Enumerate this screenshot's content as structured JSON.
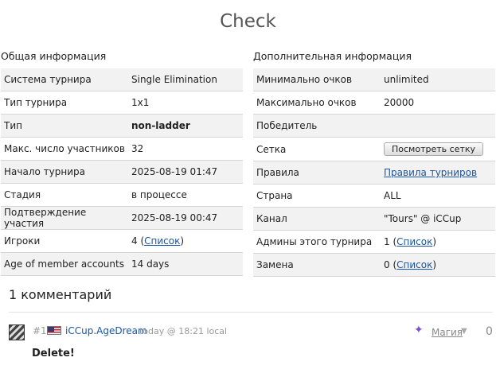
{
  "page": {
    "title": "Check"
  },
  "general": {
    "heading": "Общая информация",
    "rows": [
      {
        "key": "Система турнира",
        "value": "Single Elimination"
      },
      {
        "key": "Тип турнира",
        "value": "1x1"
      },
      {
        "key": "Тип",
        "value": "non-ladder"
      },
      {
        "key": "Макс. число участников",
        "value": "32"
      },
      {
        "key": "Начало турнира",
        "value": "2025-08-19 01:47"
      },
      {
        "key": "Стадия",
        "value": "в процессе"
      },
      {
        "key": "Подтверждение участия",
        "value": "2025-08-19 00:47"
      },
      {
        "key": "Игроки",
        "value": "4",
        "link": "Список"
      },
      {
        "key": "Age of member accounts",
        "value": "14 days"
      }
    ]
  },
  "extra": {
    "heading": "Дополнительная информация",
    "rows": [
      {
        "key": "Минимально очков",
        "value": "unlimited"
      },
      {
        "key": "Максимально очков",
        "value": "20000"
      },
      {
        "key": "Победитель",
        "value": ""
      },
      {
        "key": "Сетка",
        "button": "Посмотреть сетку"
      },
      {
        "key": "Правила",
        "link": "Правила турниров"
      },
      {
        "key": "Страна",
        "value": "ALL"
      },
      {
        "key": "Канал",
        "value": "\"Tours\" @ iCCup"
      },
      {
        "key": "Админы этого турнира",
        "value": "1",
        "link": "Список"
      },
      {
        "key": "Замена",
        "value": "0",
        "link": "Список"
      }
    ]
  },
  "comments": {
    "heading": "1 комментарий",
    "items": [
      {
        "number": "#1",
        "user": "iCCup.AgeDream",
        "meta": "today @ 18:21 local",
        "race": "Магия",
        "score": "0",
        "text": "Delete!"
      }
    ]
  },
  "icons": {
    "avatar": "user-avatar",
    "flag": "us-flag-icon",
    "race": "magic-icon",
    "caret": "chevron-down-icon"
  }
}
